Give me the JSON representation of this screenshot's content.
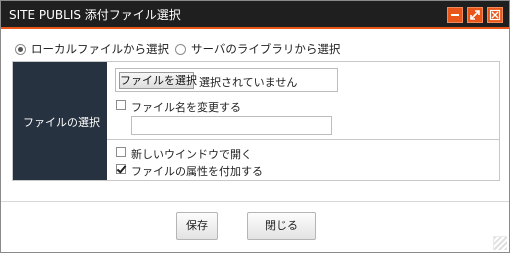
{
  "window": {
    "title": "SITE PUBLIS 添付ファイル選択",
    "controls": [
      "minimize-icon",
      "maximize-icon",
      "close-icon"
    ]
  },
  "source_options": [
    {
      "label": "ローカルファイルから選択",
      "selected": true
    },
    {
      "label": "サーバのライブラリから選択",
      "selected": false
    }
  ],
  "form": {
    "section_label": "ファイルの選択",
    "file_button": "ファイルを選択",
    "file_status": "選択されていません",
    "rename": {
      "label": "ファイル名を変更する",
      "checked": false,
      "value": ""
    },
    "open_new_window": {
      "label": "新しいウインドウで開く",
      "checked": false
    },
    "add_attributes": {
      "label": "ファイルの属性を付加する",
      "checked": true
    }
  },
  "buttons": {
    "save": "保存",
    "close": "閉じる"
  },
  "colors": {
    "accent": "#e8561a",
    "titlebar": "#1f1f1f",
    "label_cell": "#273240"
  }
}
